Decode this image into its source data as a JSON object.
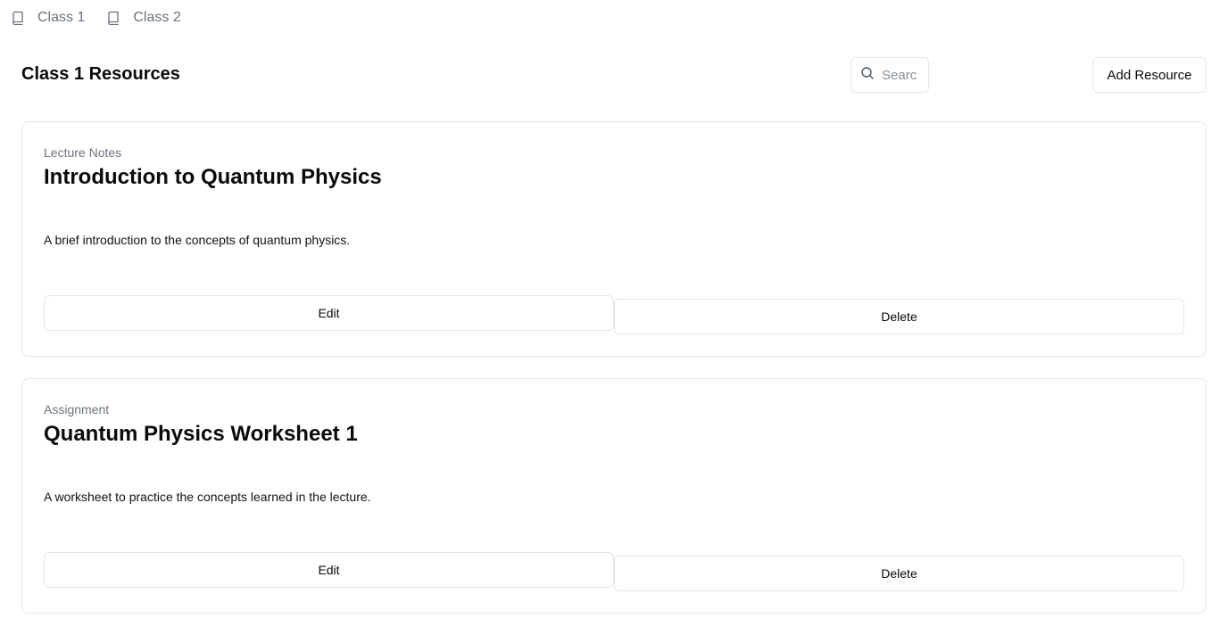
{
  "tabs": [
    {
      "label": "Class 1",
      "icon": "book-icon"
    },
    {
      "label": "Class 2",
      "icon": "book-icon"
    }
  ],
  "header": {
    "title": "Class 1 Resources",
    "search_placeholder": "Search",
    "search_value": "",
    "add_button_label": "Add Resource"
  },
  "resources": [
    {
      "type": "Lecture Notes",
      "title": "Introduction to Quantum Physics",
      "description": "A brief introduction to the concepts of quantum physics.",
      "edit_label": "Edit",
      "delete_label": "Delete"
    },
    {
      "type": "Assignment",
      "title": "Quantum Physics Worksheet 1",
      "description": "A worksheet to practice the concepts learned in the lecture.",
      "edit_label": "Edit",
      "delete_label": "Delete"
    }
  ],
  "colors": {
    "border": "#e5e7eb",
    "muted_text": "#6b7280",
    "text": "#0a0a0a"
  }
}
